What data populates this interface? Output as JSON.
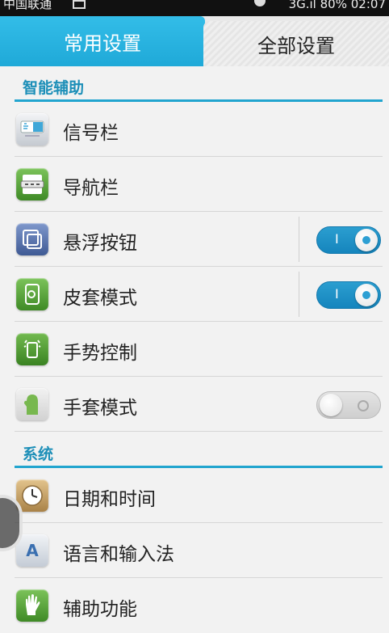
{
  "status_bar": {
    "carrier": "中国联通",
    "signal": "3G.ıl",
    "battery": "80%",
    "time": "02:07"
  },
  "tabs": [
    {
      "label": "常用设置",
      "active": true
    },
    {
      "label": "全部设置",
      "active": false
    }
  ],
  "sections": [
    {
      "title": "智能辅助",
      "items": [
        {
          "label": "信号栏",
          "icon": "signal-bar-icon",
          "color": "#d7dbe0"
        },
        {
          "label": "导航栏",
          "icon": "navigation-bar-icon",
          "color": "#5aa83a"
        },
        {
          "label": "悬浮按钮",
          "icon": "floating-button-icon",
          "color": "#5b78b2",
          "toggle": true
        },
        {
          "label": "皮套模式",
          "icon": "cover-mode-icon",
          "color": "#5aa83a",
          "toggle": true
        },
        {
          "label": "手势控制",
          "icon": "gesture-control-icon",
          "color": "#4f9b33"
        },
        {
          "label": "手套模式",
          "icon": "glove-mode-icon",
          "color": "#e6e6e6",
          "toggle": false
        }
      ]
    },
    {
      "title": "系统",
      "items": [
        {
          "label": "日期和时间",
          "icon": "clock-icon",
          "color": "#c9a46a"
        },
        {
          "label": "语言和输入法",
          "icon": "language-icon",
          "color": "#dfe3e8"
        },
        {
          "label": "辅助功能",
          "icon": "hand-icon",
          "color": "#5aa83a"
        }
      ]
    }
  ],
  "accent_color": "#22a5cf",
  "toggle_on_mark": "I"
}
